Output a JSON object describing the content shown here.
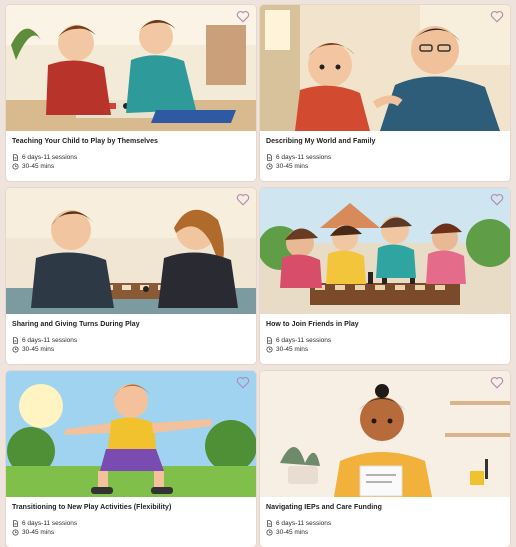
{
  "colors": {
    "page_bg": "#efe4dd",
    "card_bg": "#ffffff",
    "favorite_outline": "#b48ab8"
  },
  "cards": [
    {
      "title": "Teaching Your Child to Play by Themselves",
      "duration": "6 days-11 sessions",
      "time": "30-45 mins",
      "favorite_icon": "heart-outline-icon",
      "image": "two boys playing a board game"
    },
    {
      "title": "Describing My World and Family",
      "duration": "6 days-11 sessions",
      "time": "30-45 mins",
      "favorite_icon": "heart-outline-icon",
      "image": "father talking with son"
    },
    {
      "title": "Sharing and Giving Turns During Play",
      "duration": "6 days-11 sessions",
      "time": "30-45 mins",
      "favorite_icon": "heart-outline-icon",
      "image": "boy and girl playing checkers"
    },
    {
      "title": "How to Join Friends in Play",
      "duration": "6 days-11 sessions",
      "time": "30-45 mins",
      "favorite_icon": "heart-outline-icon",
      "image": "children playing chess together"
    },
    {
      "title": "Transitioning to New Play Activities (Flexibility)",
      "duration": "6 days-11 sessions",
      "time": "30-45 mins",
      "favorite_icon": "heart-outline-icon",
      "image": "boy playing outdoors"
    },
    {
      "title": "Navigating IEPs and Care Funding",
      "duration": "6 days-11 sessions",
      "time": "30-45 mins",
      "favorite_icon": "heart-outline-icon",
      "image": "person holding a paper"
    }
  ]
}
